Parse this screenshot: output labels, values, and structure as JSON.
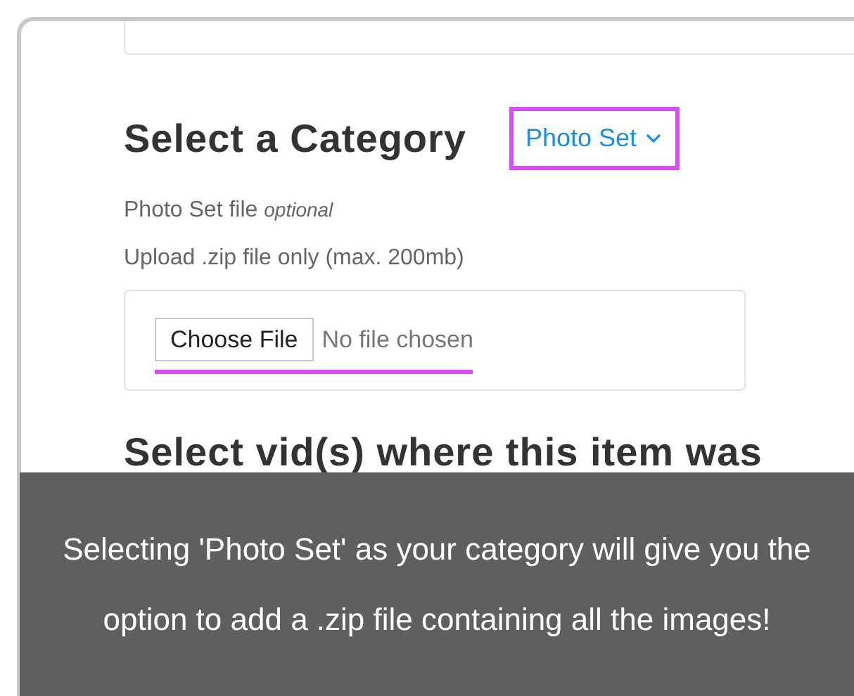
{
  "category_section": {
    "heading": "Select a Category",
    "dropdown": {
      "value": "Photo Set",
      "highlighted": true
    }
  },
  "file_field": {
    "label": "Photo Set file",
    "hint": "optional",
    "note": "Upload .zip file only (max. 200mb)",
    "button": "Choose File",
    "status": "No file chosen",
    "underlined": true
  },
  "next_heading": "Select vid(s) where this item was",
  "tooltip": {
    "text": "Selecting 'Photo Set' as your category will give you the option to add a .zip file containing all the images!"
  }
}
